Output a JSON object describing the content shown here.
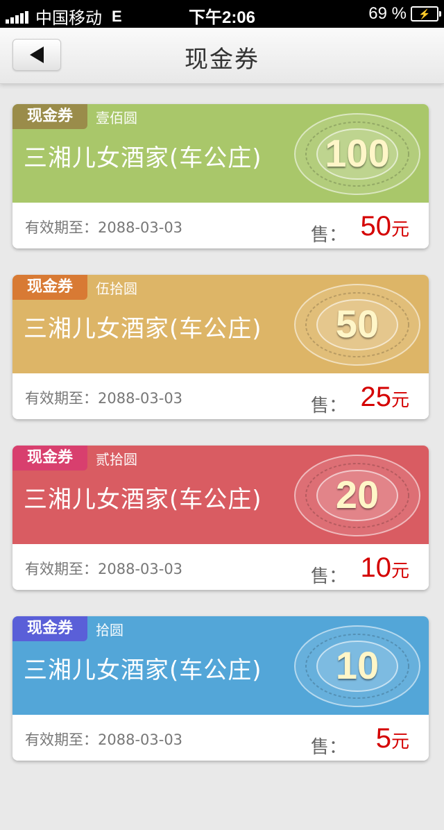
{
  "status_bar": {
    "carrier": "中国移动",
    "network": "E",
    "time": "下午2:06",
    "battery": "69 %"
  },
  "nav": {
    "back_icon": "back-arrow-icon",
    "title": "现金券"
  },
  "vouchers": [
    {
      "tag": "现金券",
      "amount_cn": "壹佰圆",
      "name": "三湘儿女酒家(车公庄)",
      "face_value": "100",
      "expiry_label": "有效期至：",
      "expiry": "2088-03-03",
      "price_label": "售：",
      "price": "50",
      "price_unit": "元",
      "color_top": "#a9c76a",
      "color_tag": "#9a8c4a"
    },
    {
      "tag": "现金券",
      "amount_cn": "伍拾圆",
      "name": "三湘儿女酒家(车公庄)",
      "face_value": "50",
      "expiry_label": "有效期至：",
      "expiry": "2088-03-03",
      "price_label": "售：",
      "price": "25",
      "price_unit": "元",
      "color_top": "#ddb567",
      "color_tag": "#d87a34"
    },
    {
      "tag": "现金券",
      "amount_cn": "贰拾圆",
      "name": "三湘儿女酒家(车公庄)",
      "face_value": "20",
      "expiry_label": "有效期至：",
      "expiry": "2088-03-03",
      "price_label": "售：",
      "price": "10",
      "price_unit": "元",
      "color_top": "#d95c62",
      "color_tag": "#d83f6e"
    },
    {
      "tag": "现金券",
      "amount_cn": "拾圆",
      "name": "三湘儿女酒家(车公庄)",
      "face_value": "10",
      "expiry_label": "有效期至：",
      "expiry": "2088-03-03",
      "price_label": "售：",
      "price": "5",
      "price_unit": "元",
      "color_top": "#53a6d8",
      "color_tag": "#5a5fd8"
    }
  ]
}
